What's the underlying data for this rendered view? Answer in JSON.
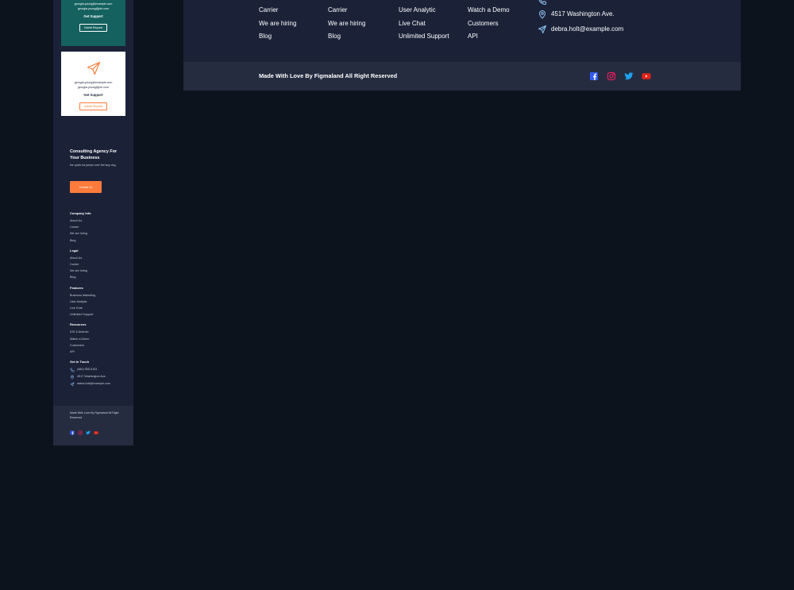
{
  "mobile": {
    "cards": [
      {
        "emails": [
          "georgia.young@example.com",
          "georgia.young@ple.com"
        ],
        "support": "Get Support",
        "request": "Submit Request"
      },
      {
        "emails": [
          "georgia.young@example.com",
          "georgia.young@ple.com"
        ],
        "support": "Get Support",
        "request": "Submit Request"
      }
    ],
    "cta": {
      "title": "Consulting Agency For Your Business",
      "subtitle": "the quick fox jumps over the lazy dog",
      "button": "Contact Us"
    },
    "groups": [
      {
        "title": "Company Info",
        "links": [
          "About Us",
          "Carrier",
          "We are hiring",
          "Blog"
        ]
      },
      {
        "title": "Legal",
        "links": [
          "About Us",
          "Carrier",
          "We are hiring",
          "Blog"
        ]
      },
      {
        "title": "Features",
        "links": [
          "Business Marketing",
          "User Analytic",
          "Live Chat",
          "Unlimited Support"
        ]
      },
      {
        "title": "Resources",
        "links": [
          "IOS & Android",
          "Watch a Demo",
          "Customers",
          "API"
        ]
      }
    ],
    "contact": {
      "title": "Get In Touch",
      "phone": "(480) 555-0103",
      "address": "4517 Washington Ave.",
      "email": "debra.holt@example.com"
    },
    "footer_text": "Made With Love By Figmaland All Right Reserved"
  },
  "desktop": {
    "columns": [
      [
        "Carrier",
        "We are hiring",
        "Blog"
      ],
      [
        "Carrier",
        "We are hiring",
        "Blog"
      ],
      [
        "User Analytic",
        "Live Chat",
        "Unlimited Support"
      ],
      [
        "Watch a Demo",
        "Customers",
        "API"
      ]
    ],
    "contact": {
      "address": "4517 Washington Ave.",
      "email": "debra.holt@example.com"
    },
    "footer_text": "Made With Love By Figmaland All Right Reserved",
    "social": [
      "facebook-icon",
      "instagram-icon",
      "twitter-icon",
      "youtube-icon"
    ]
  },
  "colors": {
    "page_bg": "#0c131c",
    "footer_bg": "#1b2238",
    "footer_bottom_bg": "#252c40",
    "teal": "#14615f",
    "accent": "#ff7b3b",
    "icon_blue": "#8ec2f2"
  }
}
